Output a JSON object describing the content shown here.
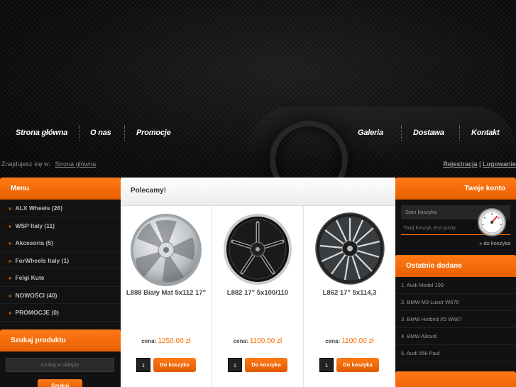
{
  "nav": {
    "home": "Strona główna",
    "about": "O nas",
    "promos": "Promocje",
    "gallery": "Galeria",
    "delivery": "Dostawa",
    "contact": "Kontakt"
  },
  "breadcrumb": {
    "prefix": "Znajdujesz się w:",
    "current": "Strona główna"
  },
  "auth": {
    "register": "Rejestracja",
    "separator": " | ",
    "login": "Logowanie"
  },
  "menu": {
    "title": "Menu",
    "items": [
      {
        "label": "ALX Wheels (26)"
      },
      {
        "label": "WSP Italy (11)"
      },
      {
        "label": "Akcesoria (5)"
      },
      {
        "label": "ForWheels Italy (1)"
      },
      {
        "label": "Felgi Kute"
      },
      {
        "label": "NOWOŚCI (40)"
      },
      {
        "label": "PROMOCJE (0)"
      }
    ]
  },
  "search": {
    "title": "Szukaj produktu",
    "placeholder": "szukaj w sklepie",
    "button": "Szukaj"
  },
  "featured": {
    "title": "Polecamy!",
    "price_label": "cena:",
    "add_label": "Do koszyka",
    "products": [
      {
        "name": "L888 Biały Mat 5x112 17\"",
        "price": "1250.00 zł",
        "qty": "1",
        "style": "silver"
      },
      {
        "name": "L882 17\" 5x100/110",
        "price": "1100.00 zł",
        "qty": "1",
        "style": "black-polished"
      },
      {
        "name": "L862 17\" 5x114,3",
        "price": "1100.00 zł",
        "qty": "1",
        "style": "black-multispoke"
      }
    ]
  },
  "account": {
    "title": "Twoje konto",
    "cart_label": "Stan koszyka",
    "cart_empty": "Twój koszyk jest pusty",
    "cart_link": "» do koszyka"
  },
  "recent": {
    "title": "Ostatnio dodane",
    "items": [
      {
        "label": "1. Audi Model 199"
      },
      {
        "label": "2. BMW M3 Luxor W670"
      },
      {
        "label": "3. BMW Hotbird X5 W667"
      },
      {
        "label": "4. BMW Alicudi"
      },
      {
        "label": "5. Audi 556 Paul"
      }
    ]
  },
  "colors": {
    "accent": "#ff7a00",
    "background": "#0b0b0b"
  }
}
